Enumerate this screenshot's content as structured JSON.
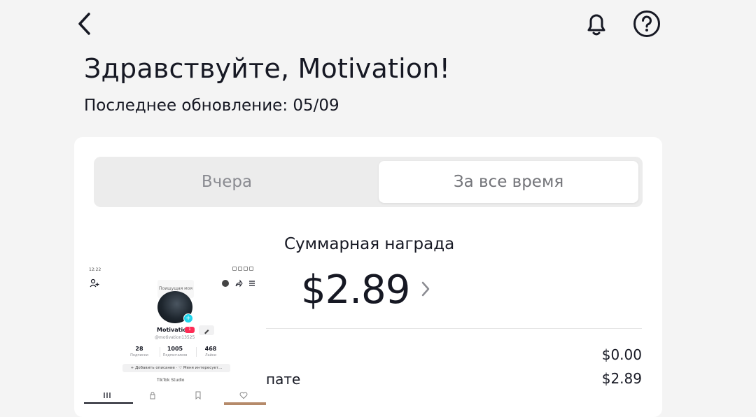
{
  "header": {
    "back_icon": "chevron-left-icon",
    "bell_icon": "bell-icon",
    "help_icon": "question-circle-icon"
  },
  "greeting": "Здравствуйте, Motivation!",
  "last_update": "Последнее обновление: 05/09",
  "tabs": [
    {
      "label": "Вчера",
      "selected": false
    },
    {
      "label": "За все время",
      "selected": true
    }
  ],
  "total": {
    "label": "Суммарная награда",
    "amount": "$2.89"
  },
  "rows": [
    {
      "label": "",
      "value": "$0.00"
    },
    {
      "label": "пате",
      "value": "$2.89"
    }
  ],
  "phone": {
    "time": "12:22",
    "mood": "Поищущая моя",
    "name": "Motivation",
    "badge": "1",
    "handle": "@motivation13525",
    "stats": [
      {
        "value": "28",
        "label": "Подписки"
      },
      {
        "value": "1005",
        "label": "Подписчиков"
      },
      {
        "value": "468",
        "label": "Лайки"
      }
    ],
    "add_bio": "+ Добавить описание · ♡ Меня интересует...",
    "studio": "TikTok Studio",
    "counter": "31"
  },
  "colors": {
    "background": "#f4f4f4",
    "card": "#ffffff",
    "segment_bg": "#ececec",
    "text": "#161823",
    "muted": "#8a8b91",
    "accent_pink": "#fe2c55",
    "accent_cyan": "#20d5ec"
  }
}
